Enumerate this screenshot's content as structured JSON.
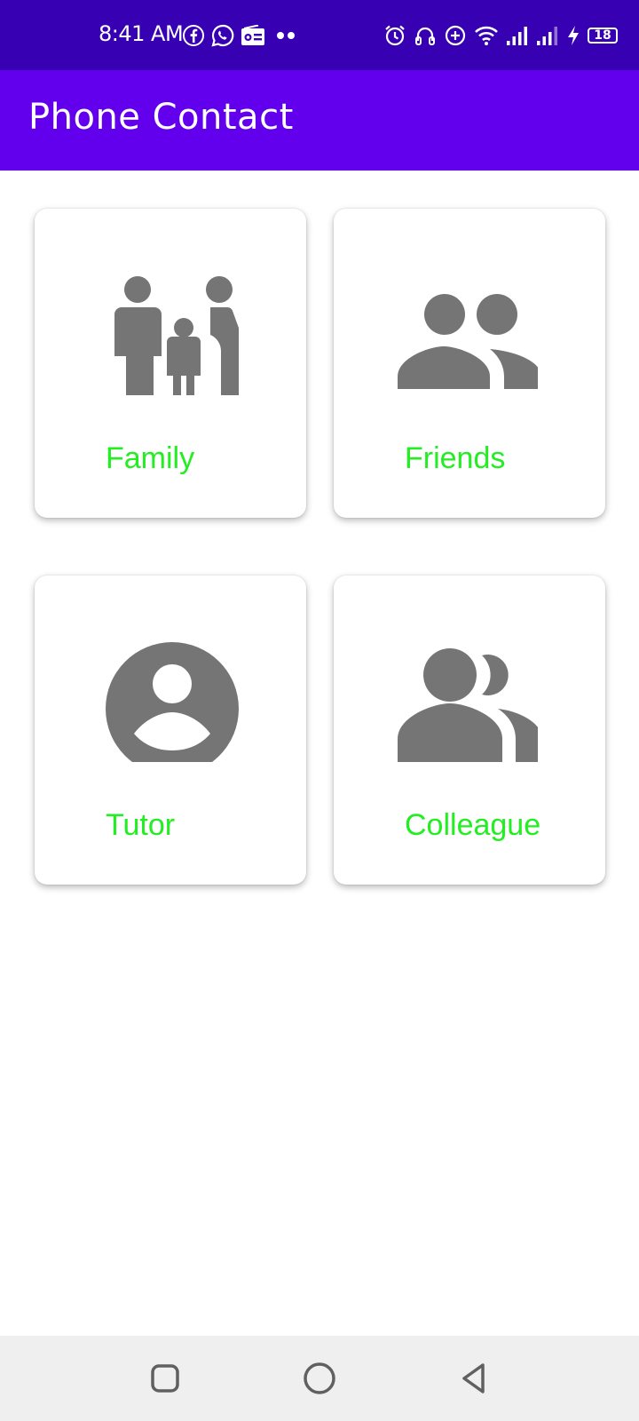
{
  "status_bar": {
    "time": "8:41 AM",
    "battery": "18",
    "left_icons": [
      "facebook-icon",
      "whatsapp-icon",
      "radio-icon",
      "more-dots-icon"
    ],
    "right_icons": [
      "alarm-icon",
      "headset-icon",
      "data-saver-icon",
      "wifi-icon",
      "signal-icon",
      "signal-icon",
      "charging-icon",
      "battery-icon"
    ]
  },
  "app_bar": {
    "title": "Phone Contact"
  },
  "categories": [
    {
      "label": "Family",
      "icon": "family-icon"
    },
    {
      "label": "Friends",
      "icon": "people-icon"
    },
    {
      "label": "Tutor",
      "icon": "account-circle-icon"
    },
    {
      "label": "Colleague",
      "icon": "group-icon"
    }
  ],
  "colors": {
    "status_bar": "#3700b3",
    "app_bar": "#6200ee",
    "label": "#22ee22",
    "icon": "#757575",
    "nav_bar": "#efefef"
  },
  "nav_bar": {
    "buttons": [
      "recents-square-icon",
      "home-circle-icon",
      "back-triangle-icon"
    ]
  }
}
